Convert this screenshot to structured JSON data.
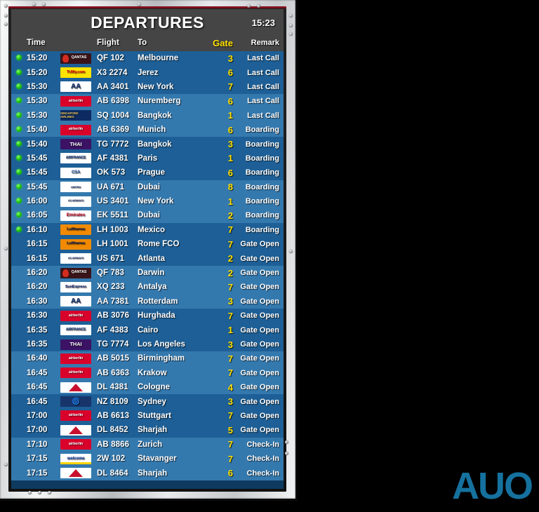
{
  "board": {
    "title": "DEPARTURES",
    "clock": "15:23",
    "columns": {
      "time": "Time",
      "flight": "Flight",
      "to": "To",
      "gate": "Gate",
      "remark": "Remark"
    },
    "colors": {
      "header_bg": "#454545",
      "row_band_a": "#1d5f96",
      "row_band_b": "#3479ae",
      "gate_text": "#ffe100",
      "row_text": "#ffffff",
      "status_dot": "#1ec412",
      "auo_logo": "#15719e"
    },
    "rows": [
      {
        "status": "active",
        "time": "15:20",
        "logo": "qantas",
        "logo_text": "QANTAS",
        "flight": "QF 102",
        "to": "Melbourne",
        "gate": "3",
        "remark": "Last Call"
      },
      {
        "status": "active",
        "time": "15:20",
        "logo": "tuifly",
        "logo_text": "TUIfly.com",
        "flight": "X3 2274",
        "to": "Jerez",
        "gate": "6",
        "remark": "Last Call"
      },
      {
        "status": "active",
        "time": "15:30",
        "logo": "aa",
        "logo_text": "AA",
        "flight": "AA 3401",
        "to": "New York",
        "gate": "7",
        "remark": "Last Call"
      },
      {
        "status": "active",
        "time": "15:30",
        "logo": "airberlin",
        "logo_text": "airberlin",
        "flight": "AB 6398",
        "to": "Nuremberg",
        "gate": "6",
        "remark": "Last Call"
      },
      {
        "status": "active",
        "time": "15:30",
        "logo": "singapore",
        "logo_text": "SINGAPORE AIRLINES",
        "flight": "SQ 1004",
        "to": "Bangkok",
        "gate": "1",
        "remark": "Last Call"
      },
      {
        "status": "active",
        "time": "15:40",
        "logo": "airberlin",
        "logo_text": "airberlin",
        "flight": "AB 6369",
        "to": "Munich",
        "gate": "6",
        "remark": "Boarding"
      },
      {
        "status": "active",
        "time": "15:40",
        "logo": "thai",
        "logo_text": "THAI",
        "flight": "TG 7772",
        "to": "Bangkok",
        "gate": "3",
        "remark": "Boarding"
      },
      {
        "status": "active",
        "time": "15:45",
        "logo": "airfrance",
        "logo_text": "AIRFRANCE",
        "flight": "AF 4381",
        "to": "Paris",
        "gate": "1",
        "remark": "Boarding"
      },
      {
        "status": "active",
        "time": "15:45",
        "logo": "csa",
        "logo_text": "CSA",
        "flight": "OK 573",
        "to": "Prague",
        "gate": "6",
        "remark": "Boarding"
      },
      {
        "status": "active",
        "time": "15:45",
        "logo": "united",
        "logo_text": "UNITED",
        "flight": "UA 671",
        "to": "Dubai",
        "gate": "8",
        "remark": "Boarding"
      },
      {
        "status": "active",
        "time": "16:00",
        "logo": "usair",
        "logo_text": "US AIRWAYS",
        "flight": "US 3401",
        "to": "New York",
        "gate": "1",
        "remark": "Boarding"
      },
      {
        "status": "active",
        "time": "16:05",
        "logo": "emirates",
        "logo_text": "Emirates",
        "flight": "EK 5511",
        "to": "Dubai",
        "gate": "2",
        "remark": "Boarding"
      },
      {
        "status": "active",
        "time": "16:10",
        "logo": "lufthansa",
        "logo_text": "Lufthansa",
        "flight": "LH 1003",
        "to": "Mexico",
        "gate": "7",
        "remark": "Boarding"
      },
      {
        "status": "none",
        "time": "16:15",
        "logo": "lufthansa",
        "logo_text": "Lufthansa",
        "flight": "LH 1001",
        "to": "Rome FCO",
        "gate": "7",
        "remark": "Gate Open"
      },
      {
        "status": "none",
        "time": "16:15",
        "logo": "usair",
        "logo_text": "US AIRWAYS",
        "flight": "US 671",
        "to": "Atlanta",
        "gate": "2",
        "remark": "Gate Open"
      },
      {
        "status": "none",
        "time": "16:20",
        "logo": "qantas",
        "logo_text": "QANTAS",
        "flight": "QF 783",
        "to": "Darwin",
        "gate": "2",
        "remark": "Gate Open"
      },
      {
        "status": "none",
        "time": "16:20",
        "logo": "sunexpress",
        "logo_text": "SunExpress",
        "flight": "XQ 233",
        "to": "Antalya",
        "gate": "7",
        "remark": "Gate Open"
      },
      {
        "status": "none",
        "time": "16:30",
        "logo": "aa",
        "logo_text": "AA",
        "flight": "AA 7381",
        "to": "Rotterdam",
        "gate": "3",
        "remark": "Gate Open"
      },
      {
        "status": "none",
        "time": "16:30",
        "logo": "airberlin",
        "logo_text": "airberlin",
        "flight": "AB 3076",
        "to": "Hurghada",
        "gate": "7",
        "remark": "Gate Open"
      },
      {
        "status": "none",
        "time": "16:35",
        "logo": "airfrance",
        "logo_text": "AIRFRANCE",
        "flight": "AF 4383",
        "to": "Cairo",
        "gate": "1",
        "remark": "Gate Open"
      },
      {
        "status": "none",
        "time": "16:35",
        "logo": "thai",
        "logo_text": "THAI",
        "flight": "TG 7774",
        "to": "Los Angeles",
        "gate": "3",
        "remark": "Gate Open"
      },
      {
        "status": "none",
        "time": "16:40",
        "logo": "airberlin",
        "logo_text": "airberlin",
        "flight": "AB 5015",
        "to": "Birmingham",
        "gate": "7",
        "remark": "Gate Open"
      },
      {
        "status": "none",
        "time": "16:45",
        "logo": "airberlin",
        "logo_text": "airberlin",
        "flight": "AB 6363",
        "to": "Krakow",
        "gate": "7",
        "remark": "Gate Open"
      },
      {
        "status": "none",
        "time": "16:45",
        "logo": "delta",
        "logo_text": "",
        "flight": "DL 4381",
        "to": "Cologne",
        "gate": "4",
        "remark": "Gate Open"
      },
      {
        "status": "none",
        "time": "16:45",
        "logo": "airnz",
        "logo_text": "",
        "flight": "NZ 8109",
        "to": "Sydney",
        "gate": "3",
        "remark": "Gate Open"
      },
      {
        "status": "none",
        "time": "17:00",
        "logo": "airberlin",
        "logo_text": "airberlin",
        "flight": "AB 6613",
        "to": "Stuttgart",
        "gate": "7",
        "remark": "Gate Open"
      },
      {
        "status": "none",
        "time": "17:00",
        "logo": "delta",
        "logo_text": "",
        "flight": "DL 8452",
        "to": "Sharjah",
        "gate": "5",
        "remark": "Gate Open"
      },
      {
        "status": "none",
        "time": "17:10",
        "logo": "airberlin",
        "logo_text": "airberlin",
        "flight": "AB 8866",
        "to": "Zurich",
        "gate": "7",
        "remark": "Check-In"
      },
      {
        "status": "none",
        "time": "17:15",
        "logo": "welcome",
        "logo_text": "welcome",
        "flight": "2W 102",
        "to": "Stavanger",
        "gate": "7",
        "remark": "Check-In"
      },
      {
        "status": "none",
        "time": "17:15",
        "logo": "delta",
        "logo_text": "",
        "flight": "DL 8464",
        "to": "Sharjah",
        "gate": "6",
        "remark": "Check-In"
      }
    ]
  },
  "branding": {
    "auo": "AUO"
  }
}
